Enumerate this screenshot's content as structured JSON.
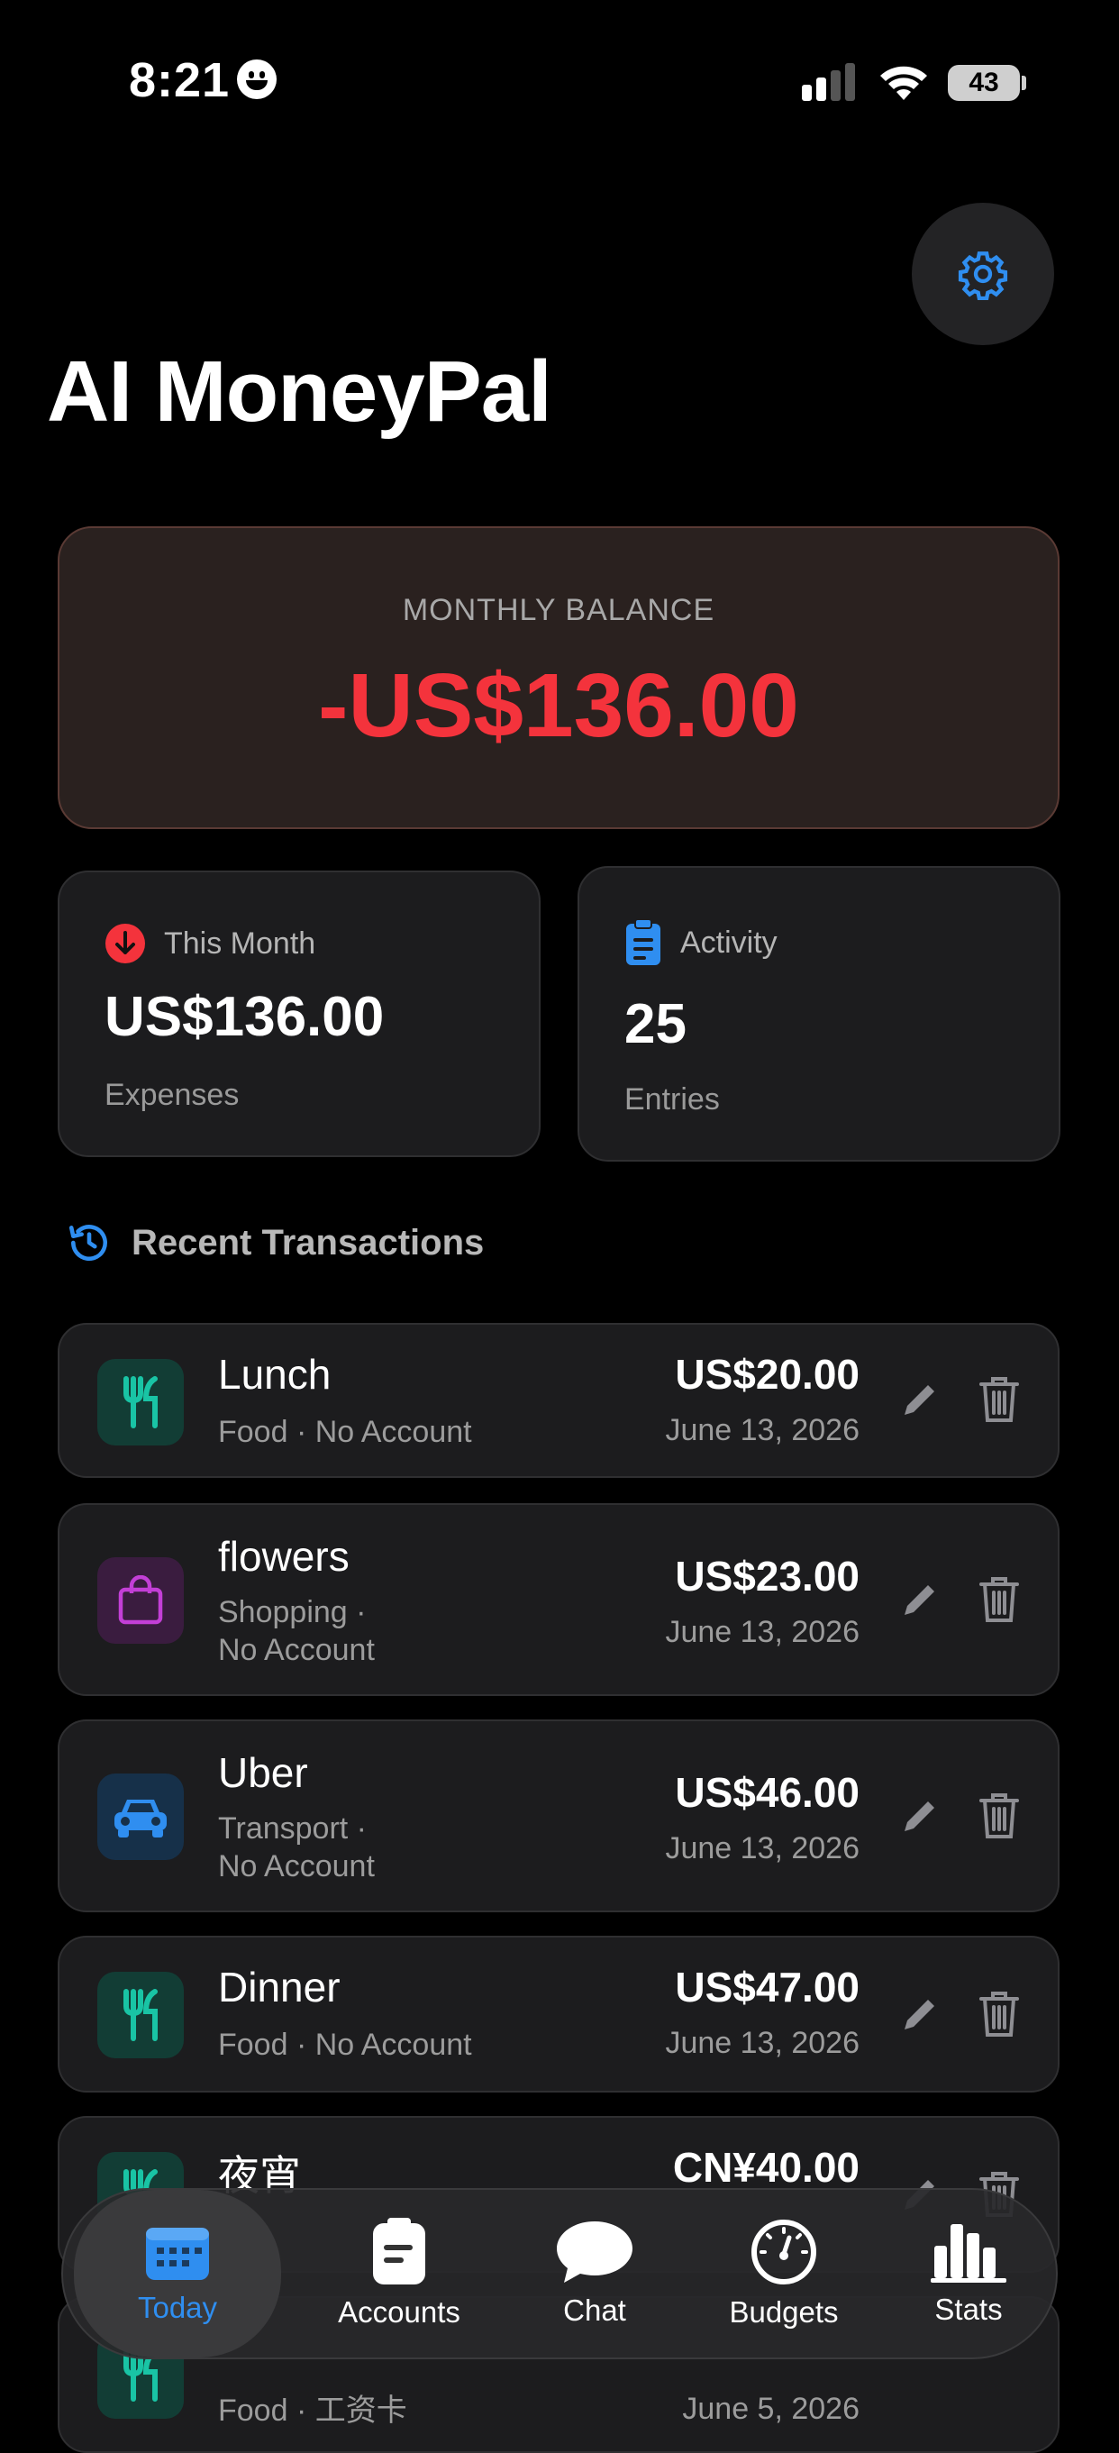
{
  "status": {
    "time": "8:21",
    "battery": "43"
  },
  "app": {
    "title": "AI MoneyPal"
  },
  "balance": {
    "label": "MONTHLY BALANCE",
    "value": "-US$136.00"
  },
  "stats": {
    "month": {
      "label": "This Month",
      "value": "US$136.00",
      "sub": "Expenses"
    },
    "activity": {
      "label": "Activity",
      "value": "25",
      "sub": "Entries"
    }
  },
  "recent": {
    "title": "Recent Transactions"
  },
  "transactions": [
    {
      "name": "Lunch",
      "meta1": "Food · No Account",
      "meta2": "",
      "amount": "US$20.00",
      "date": "June 13, 2026",
      "icon": "fork-knife-icon",
      "color": "#19c4a5"
    },
    {
      "name": "flowers",
      "meta1": "Shopping ·",
      "meta2": "No Account",
      "amount": "US$23.00",
      "date": "June 13, 2026",
      "icon": "shopping-bag-icon",
      "color": "#c33fd6"
    },
    {
      "name": "Uber",
      "meta1": "Transport ·",
      "meta2": "No Account",
      "amount": "US$46.00",
      "date": "June 13, 2026",
      "icon": "car-icon",
      "color": "#2f8ef0"
    },
    {
      "name": "Dinner",
      "meta1": "Food · No Account",
      "meta2": "",
      "amount": "US$47.00",
      "date": "June 13, 2026",
      "icon": "fork-knife-icon",
      "color": "#19c4a5"
    },
    {
      "name": "夜宵",
      "meta1": "",
      "meta2": "",
      "amount": "CN¥40.00",
      "date": "",
      "icon": "fork-knife-icon",
      "color": "#19c4a5"
    },
    {
      "name": "",
      "meta1": "Food · 工资卡",
      "meta2": "",
      "amount": "",
      "date": "June 5, 2026",
      "icon": "fork-knife-icon",
      "color": "#19c4a5"
    }
  ],
  "tabs": [
    {
      "label": "Today",
      "icon": "calendar-icon",
      "active": true
    },
    {
      "label": "Accounts",
      "icon": "document-icon",
      "active": false
    },
    {
      "label": "Chat",
      "icon": "chat-bubble-icon",
      "active": false
    },
    {
      "label": "Budgets",
      "icon": "gauge-icon",
      "active": false
    },
    {
      "label": "Stats",
      "icon": "bar-chart-icon",
      "active": false
    }
  ],
  "colors": {
    "accent": "#2f8ef0",
    "negative": "#f4333c",
    "teal": "#19c4a5"
  }
}
